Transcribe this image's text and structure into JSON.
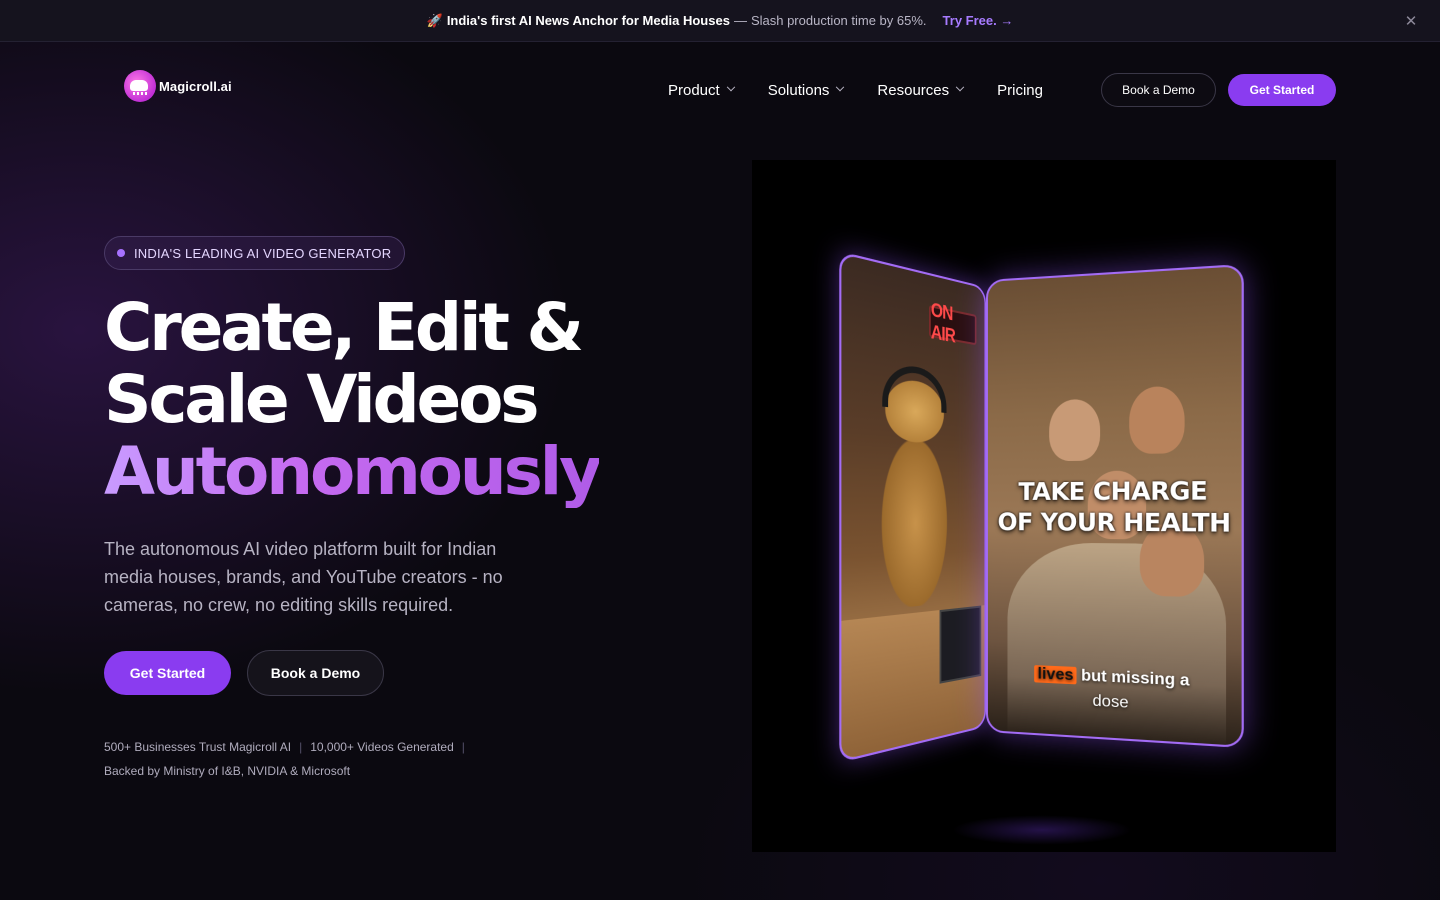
{
  "announcement": {
    "rocket": "🚀",
    "headline": "India's first AI News Anchor for Media Houses",
    "dash": "—",
    "detail": "Slash production time by 65%.",
    "cta": "Try Free. →",
    "close": "✕"
  },
  "brand": {
    "name": "Magicroll.ai"
  },
  "nav": {
    "items": [
      {
        "label": "Product",
        "has_menu": true
      },
      {
        "label": "Solutions",
        "has_menu": true
      },
      {
        "label": "Resources",
        "has_menu": true
      },
      {
        "label": "Pricing",
        "has_menu": false
      }
    ],
    "book_demo": "Book a Demo",
    "get_started": "Get Started"
  },
  "hero": {
    "eyebrow": "INDIA'S LEADING AI VIDEO GENERATOR",
    "headline_line1": "Create, Edit &",
    "headline_line2": "Scale Videos",
    "headline_accent": "Autonomously",
    "subhead": "The autonomous AI video platform built for Indian media houses, brands, and YouTube creators - no cameras, no crew, no editing skills required.",
    "primary_cta": "Get Started",
    "secondary_cta": "Book a Demo",
    "trust": {
      "item1": "500+ Businesses Trust Magicroll AI",
      "item2": "10,000+ Videos Generated",
      "item3": "Backed by Ministry of I&B, NVIDIA & Microsoft",
      "separator": "|"
    }
  },
  "video": {
    "left_card_sign": "ON AIR",
    "right_card_title_l1": "TAKE CHARGE",
    "right_card_title_l2": "OF YOUR HEALTH",
    "caption_highlight": "lives",
    "caption_rest": "but missing a",
    "caption_line2": "dose"
  },
  "colors": {
    "accent": "#8a3cf0",
    "accent_light": "#a772ff",
    "background": "#0b0910",
    "card_border": "#a36cf5"
  },
  "icons": {
    "close": "close-icon",
    "chevron": "chevron-down-icon",
    "status_dot": "dot-icon"
  }
}
